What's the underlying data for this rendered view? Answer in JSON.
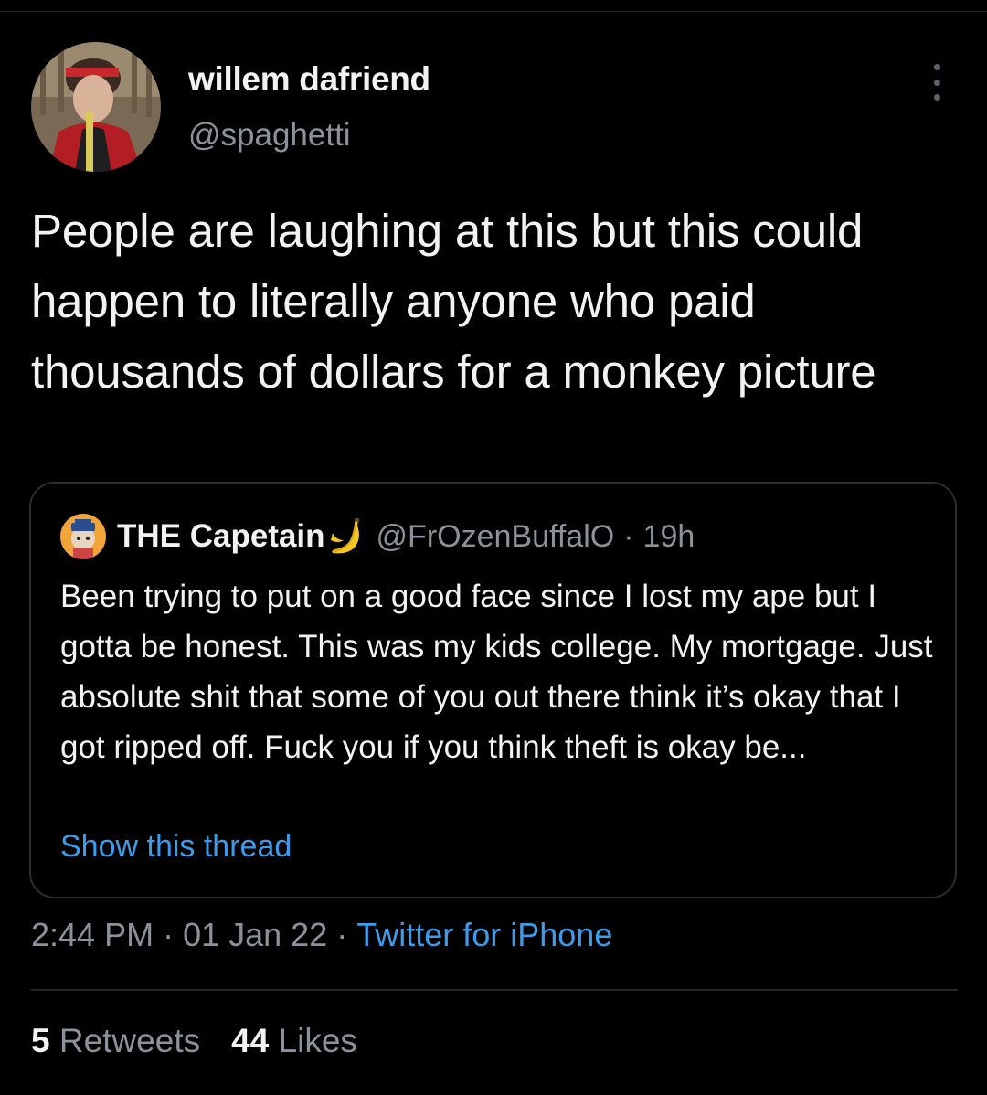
{
  "tweet": {
    "author": {
      "display_name": "willem dafriend",
      "handle": "@spaghetti",
      "avatar_icon": "profile-photo"
    },
    "more_icon": "more-vertical-icon",
    "text": "People are laughing at this but this could happen to literally anyone who paid thousands of dollars for a monkey picture",
    "quoted": {
      "display_name": "THE Capetain",
      "name_emoji_icon": "banana-icon",
      "handle": "@FrOzenBuffalO",
      "separator": "·",
      "time": "19h",
      "text": "Been trying to put on a good face since I lost my ape but I gotta be honest. This was my kids college. My mortgage. Just absolute shit that some of you out there think it’s okay that I got ripped off. Fuck you if you think theft is okay be...",
      "show_thread_label": "Show this thread"
    },
    "timestamp": {
      "time": "2:44 PM",
      "separator": "·",
      "date": "01 Jan 22",
      "source": "Twitter for iPhone"
    },
    "stats": {
      "retweets_count": "5",
      "retweets_label": "Retweets",
      "likes_count": "44",
      "likes_label": "Likes"
    }
  },
  "colors": {
    "background": "#000000",
    "primary_text": "#f2f2f2",
    "secondary_text": "#8b9299",
    "link": "#3d9be9",
    "border": "#2a2e31"
  }
}
